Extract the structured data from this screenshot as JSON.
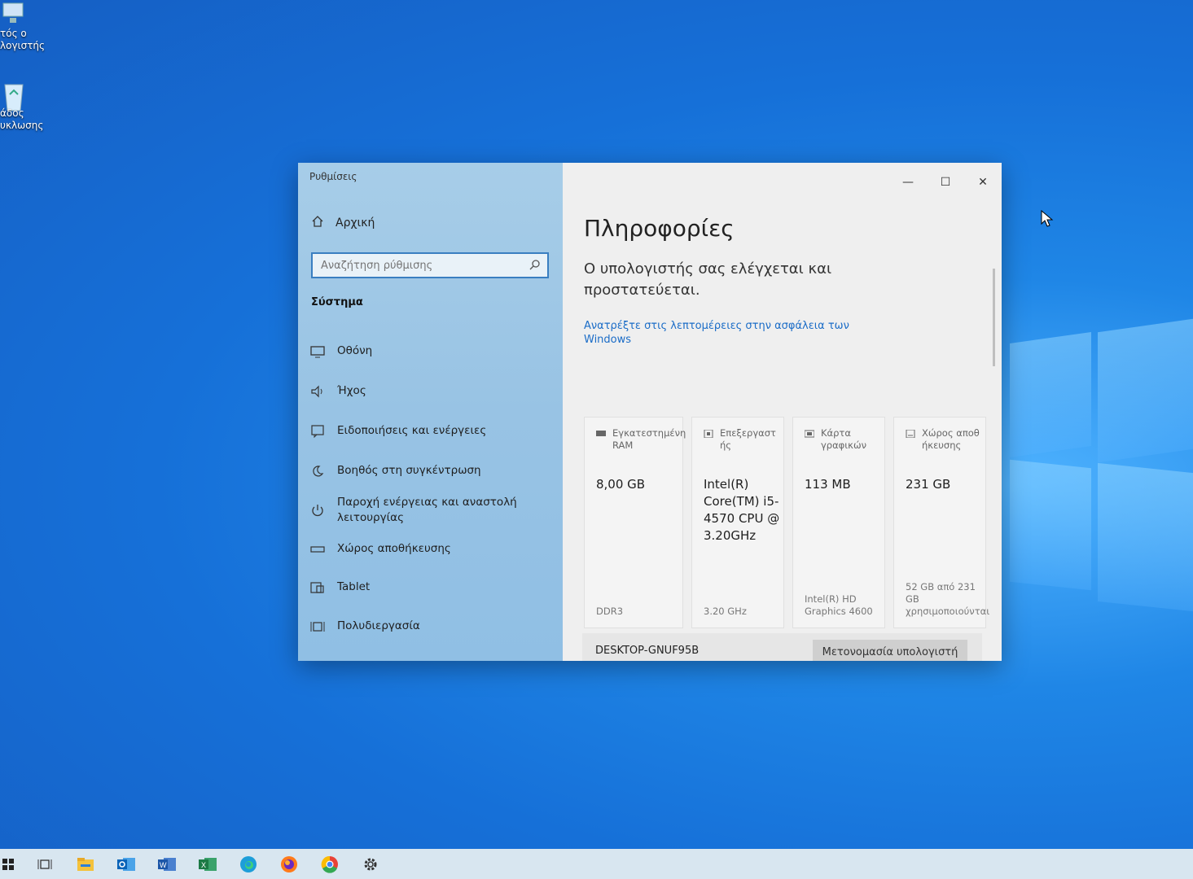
{
  "desktop": {
    "icons": [
      {
        "name": "computer",
        "label_line1": "τός ο",
        "label_line2": "λογιστής"
      },
      {
        "name": "recycle-bin",
        "label_line1": "άδος",
        "label_line2": "υκλωσης"
      }
    ]
  },
  "window": {
    "title": "Ρυθμίσεις",
    "controls": {
      "minimize": "—",
      "maximize": "☐",
      "close": "✕"
    }
  },
  "sidebar": {
    "home_label": "Αρχική",
    "search_placeholder": "Αναζήτηση ρύθμισης",
    "section_title": "Σύστημα",
    "items": [
      {
        "label": "Οθόνη",
        "icon": "display-icon"
      },
      {
        "label": "Ήχος",
        "icon": "speaker-icon"
      },
      {
        "label": "Ειδοποιήσεις και ενέργειες",
        "icon": "notification-icon"
      },
      {
        "label": "Βοηθός στη συγκέντρωση",
        "icon": "moon-icon"
      },
      {
        "label": "Παροχή ενέργειας και αναστολή λειτουργίας",
        "icon": "power-icon"
      },
      {
        "label": "Χώρος αποθήκευσης",
        "icon": "storage-icon"
      },
      {
        "label": "Tablet",
        "icon": "tablet-icon"
      },
      {
        "label": "Πολυδιεργασία",
        "icon": "multitasking-icon"
      }
    ]
  },
  "main": {
    "page_title": "Πληροφορίες",
    "protection_text": "Ο υπολογιστής σας ελέγχεται και προστατεύεται.",
    "security_link": "Ανατρέξτε στις λεπτομέρειες στην ασφάλεια των Windows",
    "cards": [
      {
        "title": "Εγκατεστημένη RAM",
        "value": "8,00 GB",
        "sub": "DDR3",
        "icon": "ram-icon"
      },
      {
        "title": "Επεξεργαστής",
        "value": "Intel(R) Core(TM) i5-4570 CPU @ 3.20GHz",
        "sub": "3.20 GHz",
        "icon": "cpu-icon"
      },
      {
        "title": "Κάρτα γραφικών",
        "value": "113 MB",
        "sub": "Intel(R) HD Graphics 4600",
        "icon": "gpu-icon"
      },
      {
        "title": "Χώρος αποθήκευσης",
        "value": "231 GB",
        "sub": "52 GB από 231 GB χρησιμοποιούνται",
        "icon": "disk-icon"
      }
    ],
    "device_name": "DESKTOP-GNUF95B",
    "rename_button": "Μετονομασία υπολογιστή"
  },
  "taskbar": {
    "items": [
      "start-icon",
      "task-view-icon",
      "file-explorer-icon",
      "outlook-icon",
      "word-icon",
      "excel-icon",
      "edge-icon",
      "firefox-icon",
      "chrome-icon",
      "settings-icon"
    ]
  }
}
